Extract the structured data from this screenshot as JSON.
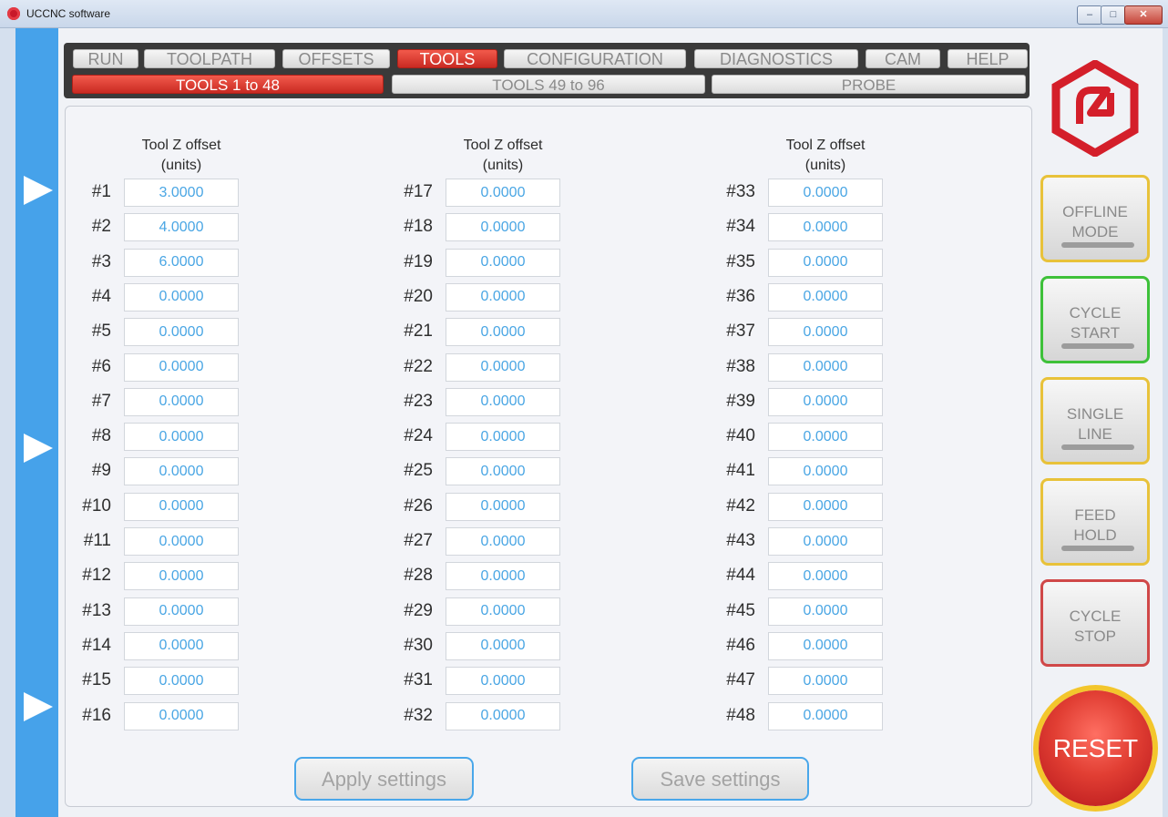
{
  "window": {
    "title": "UCCNC software"
  },
  "menu": {
    "tabs": [
      "RUN",
      "TOOLPATH",
      "OFFSETS",
      "TOOLS",
      "CONFIGURATION",
      "DIAGNOSTICS",
      "CAM",
      "HELP"
    ],
    "active_tab": "TOOLS",
    "subtabs": [
      "TOOLS  1 to 48",
      "TOOLS  49 to 96",
      "PROBE"
    ],
    "active_subtab": "TOOLS  1 to 48"
  },
  "columns": [
    {
      "header1": "Tool Z offset",
      "header2": "(units)"
    },
    {
      "header1": "Tool Z offset",
      "header2": "(units)"
    },
    {
      "header1": "Tool Z offset",
      "header2": "(units)"
    }
  ],
  "tools": [
    {
      "label": "#1",
      "value": "3.0000"
    },
    {
      "label": "#2",
      "value": "4.0000"
    },
    {
      "label": "#3",
      "value": "6.0000"
    },
    {
      "label": "#4",
      "value": "0.0000"
    },
    {
      "label": "#5",
      "value": "0.0000"
    },
    {
      "label": "#6",
      "value": "0.0000"
    },
    {
      "label": "#7",
      "value": "0.0000"
    },
    {
      "label": "#8",
      "value": "0.0000"
    },
    {
      "label": "#9",
      "value": "0.0000"
    },
    {
      "label": "#10",
      "value": "0.0000"
    },
    {
      "label": "#11",
      "value": "0.0000"
    },
    {
      "label": "#12",
      "value": "0.0000"
    },
    {
      "label": "#13",
      "value": "0.0000"
    },
    {
      "label": "#14",
      "value": "0.0000"
    },
    {
      "label": "#15",
      "value": "0.0000"
    },
    {
      "label": "#16",
      "value": "0.0000"
    },
    {
      "label": "#17",
      "value": "0.0000"
    },
    {
      "label": "#18",
      "value": "0.0000"
    },
    {
      "label": "#19",
      "value": "0.0000"
    },
    {
      "label": "#20",
      "value": "0.0000"
    },
    {
      "label": "#21",
      "value": "0.0000"
    },
    {
      "label": "#22",
      "value": "0.0000"
    },
    {
      "label": "#23",
      "value": "0.0000"
    },
    {
      "label": "#24",
      "value": "0.0000"
    },
    {
      "label": "#25",
      "value": "0.0000"
    },
    {
      "label": "#26",
      "value": "0.0000"
    },
    {
      "label": "#27",
      "value": "0.0000"
    },
    {
      "label": "#28",
      "value": "0.0000"
    },
    {
      "label": "#29",
      "value": "0.0000"
    },
    {
      "label": "#30",
      "value": "0.0000"
    },
    {
      "label": "#31",
      "value": "0.0000"
    },
    {
      "label": "#32",
      "value": "0.0000"
    },
    {
      "label": "#33",
      "value": "0.0000"
    },
    {
      "label": "#34",
      "value": "0.0000"
    },
    {
      "label": "#35",
      "value": "0.0000"
    },
    {
      "label": "#36",
      "value": "0.0000"
    },
    {
      "label": "#37",
      "value": "0.0000"
    },
    {
      "label": "#38",
      "value": "0.0000"
    },
    {
      "label": "#39",
      "value": "0.0000"
    },
    {
      "label": "#40",
      "value": "0.0000"
    },
    {
      "label": "#41",
      "value": "0.0000"
    },
    {
      "label": "#42",
      "value": "0.0000"
    },
    {
      "label": "#43",
      "value": "0.0000"
    },
    {
      "label": "#44",
      "value": "0.0000"
    },
    {
      "label": "#45",
      "value": "0.0000"
    },
    {
      "label": "#46",
      "value": "0.0000"
    },
    {
      "label": "#47",
      "value": "0.0000"
    },
    {
      "label": "#48",
      "value": "0.0000"
    }
  ],
  "actions": {
    "apply": "Apply settings",
    "save": "Save settings"
  },
  "side_buttons": [
    {
      "line1": "OFFLINE",
      "line2": "MODE",
      "border_color": "#e8c23a",
      "has_bar": true
    },
    {
      "line1": "CYCLE",
      "line2": "START",
      "border_color": "#3ec13a",
      "has_bar": true
    },
    {
      "line1": "SINGLE",
      "line2": "LINE",
      "border_color": "#e8c23a",
      "has_bar": true
    },
    {
      "line1": "FEED",
      "line2": "HOLD",
      "border_color": "#e8c23a",
      "has_bar": true
    },
    {
      "line1": "CYCLE",
      "line2": "STOP",
      "border_color": "#d04848",
      "has_bar": false
    }
  ],
  "reset": {
    "label": "RESET"
  },
  "colors": {
    "accent_blue": "#46a2ea",
    "active_red": "#e03a2f",
    "value_blue": "#4aa6e4"
  }
}
